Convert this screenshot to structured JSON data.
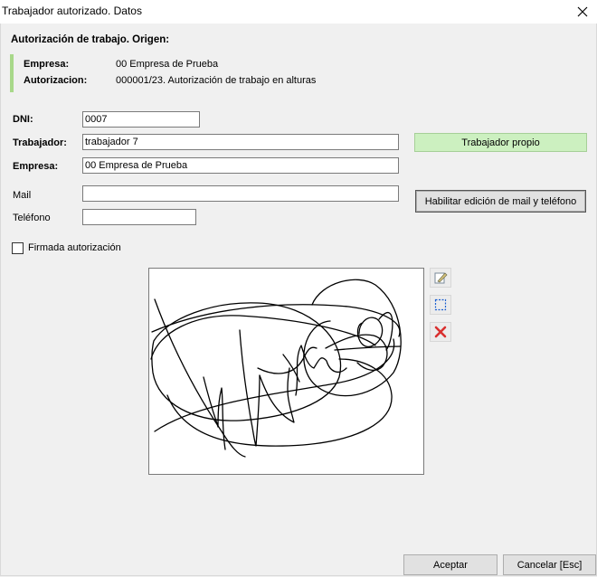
{
  "window": {
    "title": "Trabajador autorizado. Datos",
    "close_icon": "close-icon"
  },
  "section": {
    "title": "Autorización de trabajo. Origen:"
  },
  "origin": {
    "empresa_label": "Empresa:",
    "empresa_value": "00 Empresa de Prueba",
    "autorizacion_label": "Autorizacion:",
    "autorizacion_value": "000001/23. Autorización de trabajo en alturas"
  },
  "form": {
    "dni_label": "DNI:",
    "dni_value": "0007",
    "trabajador_label": "Trabajador:",
    "trabajador_value": "trabajador 7",
    "empresa_label": "Empresa:",
    "empresa_value": "00 Empresa de Prueba",
    "mail_label": "Mail",
    "mail_value": "",
    "telefono_label": "Teléfono",
    "telefono_value": "",
    "firmada_label": "Firmada autorización",
    "firmada_checked": false
  },
  "buttons": {
    "trabajador_propio": "Trabajador propio",
    "habilitar": "Habilitar edición de mail y teléfono",
    "aceptar": "Aceptar",
    "cancelar": "Cancelar [Esc]"
  },
  "signature_tools": {
    "edit_icon": "edit-signature-icon",
    "select_icon": "select-area-icon",
    "delete_icon": "delete-signature-icon"
  },
  "colors": {
    "accent_green": "#ccf0c0",
    "origin_bar": "#a8d88a",
    "delete_red": "#d9302f"
  }
}
